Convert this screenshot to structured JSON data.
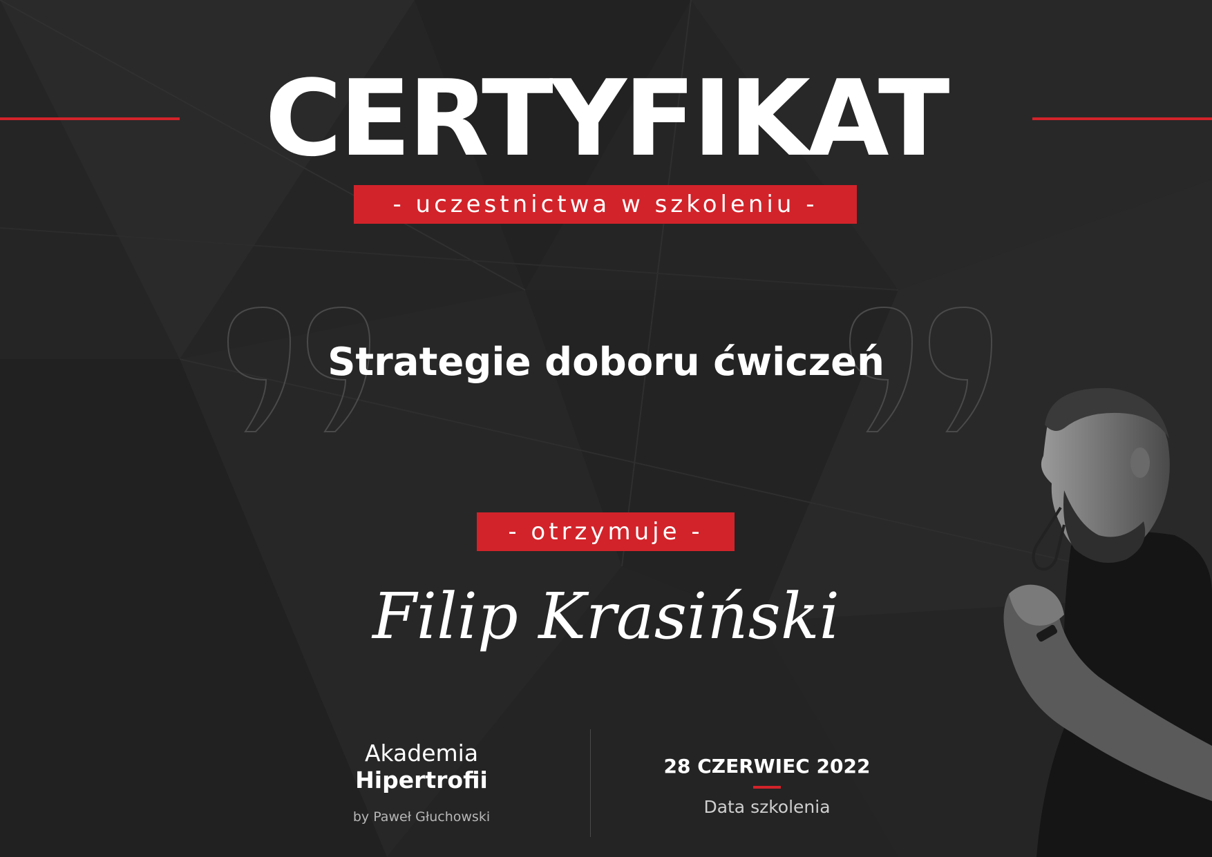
{
  "certificate": {
    "title": "CERTYFIKAT",
    "subtitle": "- uczestnictwa w szkoleniu -",
    "course_title": "Strategie doboru ćwiczeń",
    "receives_label": "- otrzymuje -",
    "recipient_name": "Filip Krasiński"
  },
  "footer": {
    "logo": {
      "line1": "Akademia",
      "line2": "Hipertrofii",
      "byline": "by Paweł Głuchowski"
    },
    "date": {
      "value": "28 CZERWIEC 2022",
      "label": "Data szkolenia"
    }
  },
  "colors": {
    "background": "#252525",
    "accent": "#d2232a",
    "text": "#ffffff"
  },
  "icons": {
    "quote_left": "quotation-mark-icon",
    "quote_right": "quotation-mark-icon"
  }
}
